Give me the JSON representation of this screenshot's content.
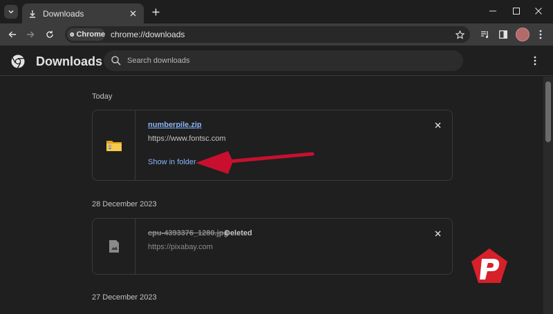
{
  "window": {
    "tab_title": "Downloads",
    "icons": [
      "tab-search-icon",
      "download-icon",
      "close-icon",
      "plus-icon",
      "minimize-icon",
      "maximize-icon",
      "close-window-icon"
    ]
  },
  "toolbar": {
    "chip_label": "Chrome",
    "url": "chrome://downloads"
  },
  "page": {
    "title": "Downloads",
    "search_placeholder": "Search downloads"
  },
  "groups": [
    {
      "date": "Today",
      "items": [
        {
          "file_name": "numberpile.zip",
          "url": "https://www.fontsc.com",
          "action": "Show in folder",
          "icon": "folder-icon"
        }
      ]
    },
    {
      "date": "28 December 2023",
      "items": [
        {
          "file_name": "cpu-4393376_1280.jpg",
          "status": "Deleted",
          "url": "https://pixabay.com",
          "icon": "image-file-icon"
        }
      ]
    },
    {
      "date": "27 December 2023",
      "items": []
    }
  ],
  "colors": {
    "background": "#1f1f1f",
    "link": "#8ab4f8",
    "annotation_arrow": "#c8102e",
    "badge": "#d6202a"
  }
}
